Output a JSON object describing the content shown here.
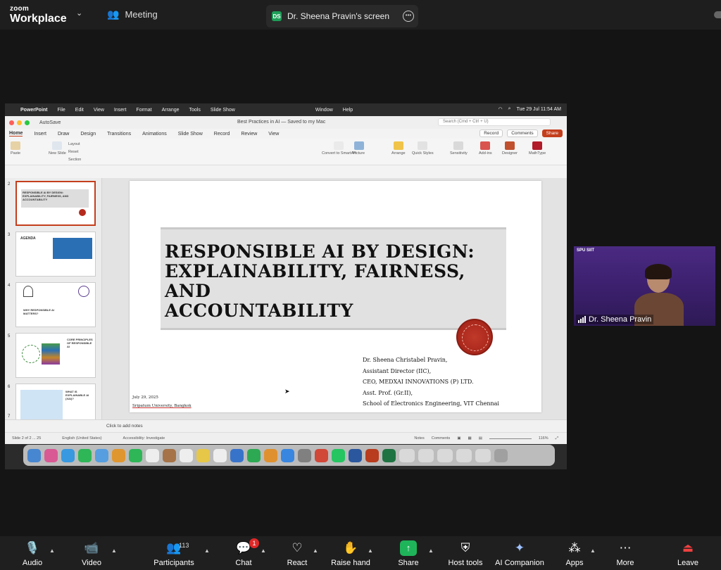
{
  "zoom": {
    "brand_small": "zoom",
    "brand_large": "Workplace",
    "meeting_label": "Meeting",
    "screen_tab": "Dr. Sheena Pravin's screen",
    "screen_tab_initials": "DS"
  },
  "mac": {
    "app": "PowerPoint",
    "menus": [
      "File",
      "Edit",
      "View",
      "Insert",
      "Format",
      "Arrange",
      "Tools",
      "Slide Show"
    ],
    "menus_right": [
      "Window",
      "Help"
    ],
    "clock": "Tue 29 Jul  11:54 AM"
  },
  "ppt": {
    "autosave": "AutoSave",
    "doc_title": "Best Practices in AI — Saved to my Mac",
    "search_placeholder": "Search (Cmd + Ctrl + U)",
    "tabs": [
      "Home",
      "Insert",
      "Draw",
      "Design",
      "Transitions",
      "Animations",
      "Slide Show",
      "Record",
      "Review",
      "View"
    ],
    "record_btn": "Record",
    "comments_btn": "Comments",
    "share_btn": "Share",
    "ribbon": {
      "paste": "Paste",
      "new_slide": "New Slide",
      "layout": "Layout",
      "reset": "Reset",
      "section": "Section",
      "convert": "Convert to SmartArt",
      "picture": "Picture",
      "arrange": "Arrange",
      "quick_styles": "Quick Styles",
      "sensitivity": "Sensitivity",
      "addins": "Add-ins",
      "designer": "Designer",
      "mathtype": "MathType"
    },
    "thumb_numbers": [
      "2",
      "3",
      "4",
      "5",
      "6",
      "7"
    ],
    "thumbs": [
      "RESPONSIBLE AI BY DESIGN: EXPLAINABILITY, FAIRNESS, AND ACCOUNTABILITY",
      "AGENDA",
      "WHY RESPONSIBLE AI MATTERS?",
      "CORE PRINCIPLES OF RESPONSIBLE AI",
      "WHAT IS EXPLAINABLE AI (XAI)?"
    ],
    "slide": {
      "title_line1": "RESPONSIBLE AI BY DESIGN:",
      "title_line2": "EXPLAINABILITY, FAIRNESS, AND",
      "title_line3": "ACCOUNTABILITY",
      "author": [
        "Dr. Sheena Christabel Pravin,",
        "Assistant Director (IIC),",
        "CEO, MEDXAI INNOVATIONS (P) LTD.",
        "Asst. Prof. (Gr.II),",
        "School of Electronics Engineering, VIT Chennai"
      ],
      "date": "July 29, 2025",
      "venue": "Sripatum University, Bangkok"
    },
    "notes": "Click to add notes",
    "status_slide": "Slide 2 of 2 ... 25",
    "status_lang": "English (United States)",
    "status_access": "Accessibility: Investigate",
    "status_notes": "Notes",
    "status_comments": "Comments",
    "zoom_level": "116%"
  },
  "video": {
    "name": "Dr. Sheena Pravin",
    "header": "SPU SIIT"
  },
  "toolbar": {
    "audio": "Audio",
    "video": "Video",
    "participants": "Participants",
    "participants_count": "113",
    "chat": "Chat",
    "chat_badge": "1",
    "react": "React",
    "raise_hand": "Raise hand",
    "share": "Share",
    "host_tools": "Host tools",
    "ai_companion": "AI Companion",
    "apps": "Apps",
    "more": "More",
    "leave": "Leave"
  },
  "colors": {
    "share_green": "#1fb45a",
    "ppt_accent": "#c43e1c",
    "leave_red": "#f04040"
  }
}
